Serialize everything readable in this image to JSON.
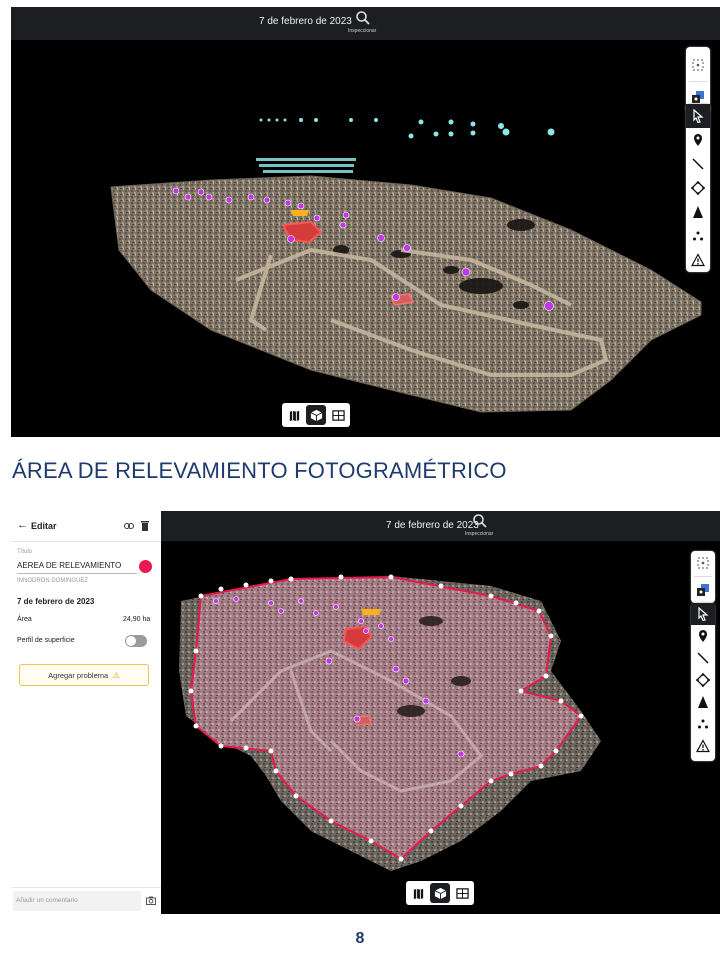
{
  "screenshot_top": {
    "date": "7 de febrero de 2023",
    "inspect_label": "Inspeccionar",
    "toolbar_icons": [
      "focus-icon",
      "layers-icon",
      "cursor-icon",
      "pin-icon",
      "line-icon",
      "polygon-icon",
      "cone-icon",
      "dots-icon",
      "warning-icon"
    ],
    "view_modes": [
      "map-view-icon",
      "3d-view-icon",
      "split-view-icon"
    ],
    "active_view": "3d-view-icon"
  },
  "section_title": "ÁREA DE RELEVAMIENTO FOTOGRAMÉTRICO",
  "panel": {
    "back_label": "Editar",
    "title_field_label": "Título",
    "title_value": "AEREA DE RELEVAMIENTO",
    "color_dot": "#e8194f",
    "author": "INNODRON DOMINGUEZ",
    "date": "7 de febrero de 2023",
    "area_label": "Área",
    "area_value": "24,90 ha",
    "surface_profile_label": "Perfil de superficie",
    "surface_profile_on": false,
    "add_problem_label": "Agregar problema",
    "comment_placeholder": "Añadir un comentario"
  },
  "screenshot_bottom": {
    "date": "7 de febrero de 2023",
    "inspect_label": "Inspeccionar"
  },
  "page_number": "8",
  "colors": {
    "title_blue": "#1f3a6d",
    "marker_purple": "#c335e8",
    "polygon_red": "#e8194f",
    "panel_accent": "#1d76d6"
  }
}
